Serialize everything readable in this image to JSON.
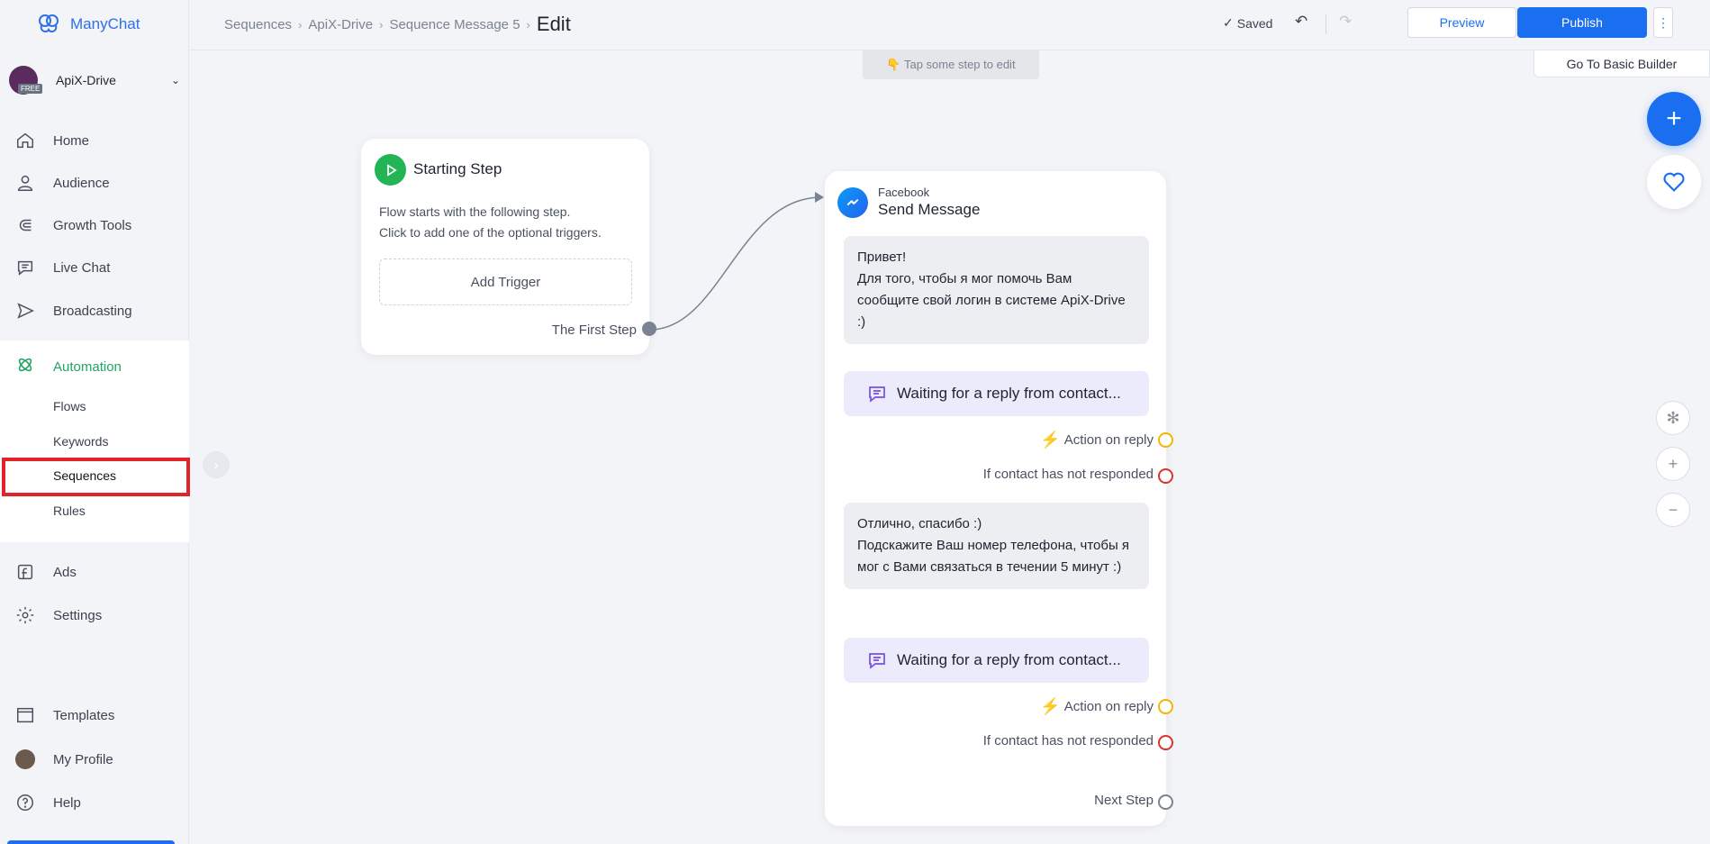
{
  "app": {
    "name": "ManyChat"
  },
  "account": {
    "name": "ApiX-Drive",
    "badge": "FREE"
  },
  "sidebar": {
    "items": [
      {
        "label": "Home",
        "icon": "home-icon"
      },
      {
        "label": "Audience",
        "icon": "person-icon"
      },
      {
        "label": "Growth Tools",
        "icon": "magnet-icon"
      },
      {
        "label": "Live Chat",
        "icon": "chat-icon"
      },
      {
        "label": "Broadcasting",
        "icon": "send-icon"
      }
    ],
    "automation": {
      "label": "Automation",
      "sub": [
        "Flows",
        "Keywords",
        "Sequences",
        "Rules"
      ],
      "active": "Sequences"
    },
    "items2": [
      {
        "label": "Ads",
        "icon": "facebook-ads-icon"
      },
      {
        "label": "Settings",
        "icon": "gear-icon"
      }
    ],
    "bottom": [
      {
        "label": "Templates",
        "icon": "templates-icon"
      },
      {
        "label": "My Profile",
        "icon": "avatar"
      },
      {
        "label": "Help",
        "icon": "help-icon"
      }
    ]
  },
  "breadcrumb": {
    "items": [
      "Sequences",
      "ApiX-Drive",
      "Sequence Message 5"
    ],
    "current": "Edit"
  },
  "toolbar": {
    "saved": "Saved",
    "preview": "Preview",
    "publish": "Publish",
    "more": "⋮"
  },
  "canvas": {
    "hint": "👇 Tap some step to edit",
    "basic_builder": "Go To Basic Builder"
  },
  "start_step": {
    "title": "Starting Step",
    "desc_line1": "Flow starts with the following step.",
    "desc_line2": "Click to add one of the optional triggers.",
    "add_trigger": "Add Trigger",
    "first_step": "The First Step"
  },
  "message_step": {
    "channel": "Facebook",
    "title": "Send Message",
    "blocks": [
      {
        "text_lines": [
          "Привет!",
          "Для того, чтобы я мог помочь Вам сообщите свой логин в системе ApiX-Drive :)"
        ],
        "waiting": "Waiting for a reply from contact...",
        "action": "Action on reply",
        "no_response": "If contact has not responded"
      },
      {
        "text_lines": [
          "Отлично, спасибо :)",
          "Подскажите Ваш номер телефона, чтобы я мог с Вами связаться в течении 5 минут :)"
        ],
        "waiting": "Waiting for a reply from contact...",
        "action": "Action on reply",
        "no_response": "If contact has not responded"
      }
    ],
    "next_step": "Next Step"
  },
  "colors": {
    "accent": "#1a6ff0",
    "automation_green": "#1fa463",
    "highlight_red": "#e1232b",
    "action_yellow": "#f5b400",
    "no_response_red": "#d9342b"
  }
}
